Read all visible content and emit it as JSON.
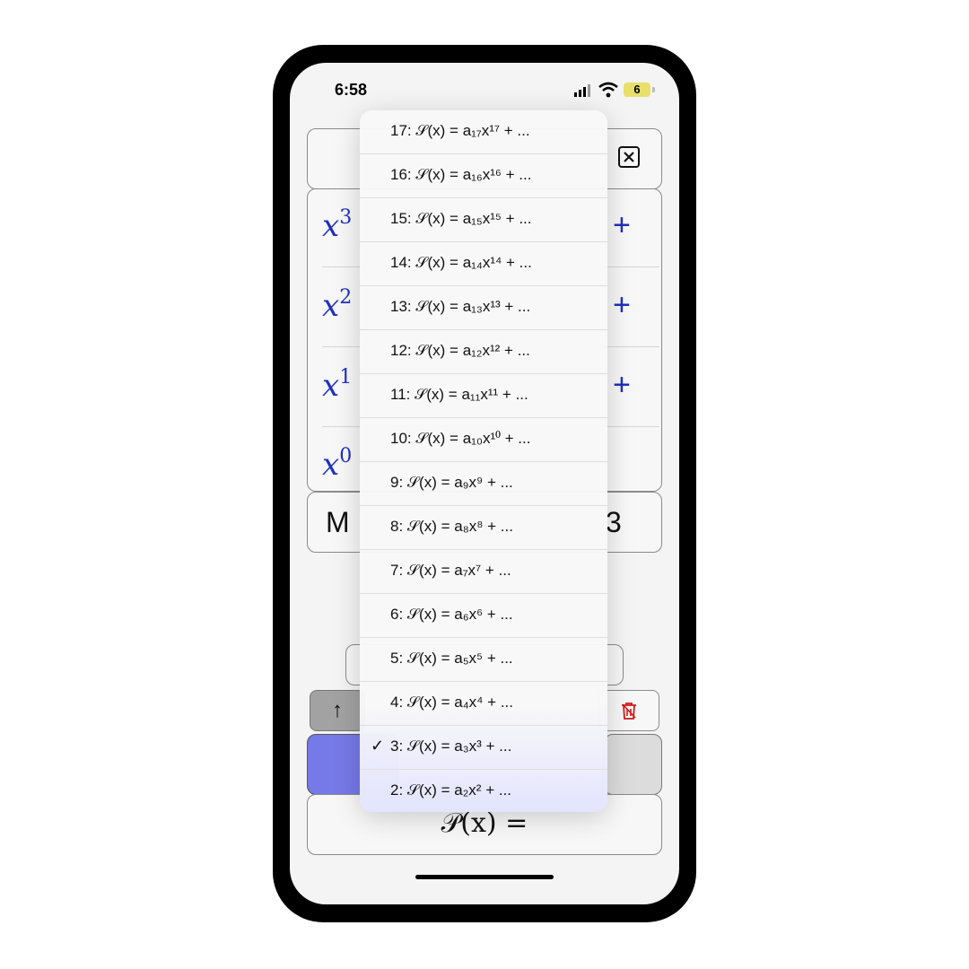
{
  "status": {
    "time": "6:58",
    "battery": "6"
  },
  "background": {
    "terms": [
      "x",
      "x",
      "x",
      "x"
    ],
    "exponents": [
      "3",
      "2",
      "1",
      "0"
    ],
    "plus": "+",
    "m_label": "M",
    "m_value": "3",
    "up_label": "↑",
    "poly_label": "𝒫(x) ="
  },
  "menu": {
    "items": [
      "17: 𝒮(x) = a₁₇x¹⁷ + ...",
      "16: 𝒮(x) = a₁₆x¹⁶ + ...",
      "15: 𝒮(x) = a₁₅x¹⁵ + ...",
      "14: 𝒮(x) = a₁₄x¹⁴ + ...",
      "13: 𝒮(x) = a₁₃x¹³ + ...",
      "12: 𝒮(x) = a₁₂x¹² + ...",
      "11: 𝒮(x) = a₁₁x¹¹ + ...",
      "10: 𝒮(x) = a₁₀x¹⁰ + ...",
      "9: 𝒮(x) = a₉x⁹ + ...",
      "8: 𝒮(x) = a₈x⁸ + ...",
      "7: 𝒮(x) = a₇x⁷ + ...",
      "6: 𝒮(x) = a₆x⁶ + ...",
      "5: 𝒮(x) = a₅x⁵ + ...",
      "4: 𝒮(x) = a₄x⁴ + ...",
      "3: 𝒮(x) = a₃x³ + ...",
      "2: 𝒮(x) = a₂x² + ..."
    ],
    "selected_label": "3: 𝒮(x) = a₃x³ + ...",
    "check": "✓"
  },
  "colors": {
    "accent": "#1f2fbf",
    "purple": "#7679e8",
    "trash": "#d11a1a"
  }
}
